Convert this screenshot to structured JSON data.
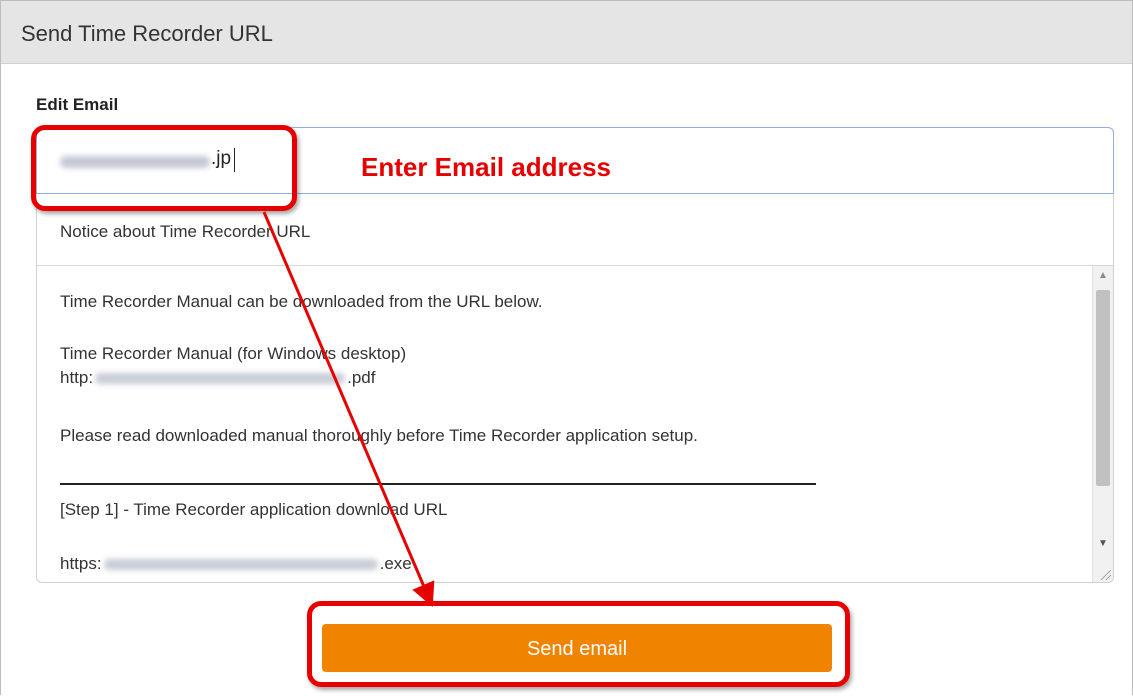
{
  "dialog": {
    "title": "Send Time Recorder URL"
  },
  "form": {
    "edit_email_label": "Edit Email",
    "email_value_visible_suffix": ".jp"
  },
  "notice": {
    "subject": "Notice about Time Recorder URL",
    "line1": "Time Recorder Manual can be downloaded from the URL below.",
    "line2": "Time Recorder Manual (for Windows desktop)",
    "line3_prefix": "http:",
    "line3_suffix": ".pdf",
    "line4": "Please read downloaded manual thoroughly before Time Recorder application setup.",
    "line5": "[Step 1] - Time Recorder application download URL",
    "line6_prefix": "https:",
    "line6_suffix": ".exe"
  },
  "actions": {
    "send_label": "Send email"
  },
  "annotations": {
    "enter_email_text": "Enter Email address",
    "highlight_color": "#e60000"
  },
  "colors": {
    "button_orange": "#f08300",
    "title_bar_gray": "#e5e5e5"
  }
}
